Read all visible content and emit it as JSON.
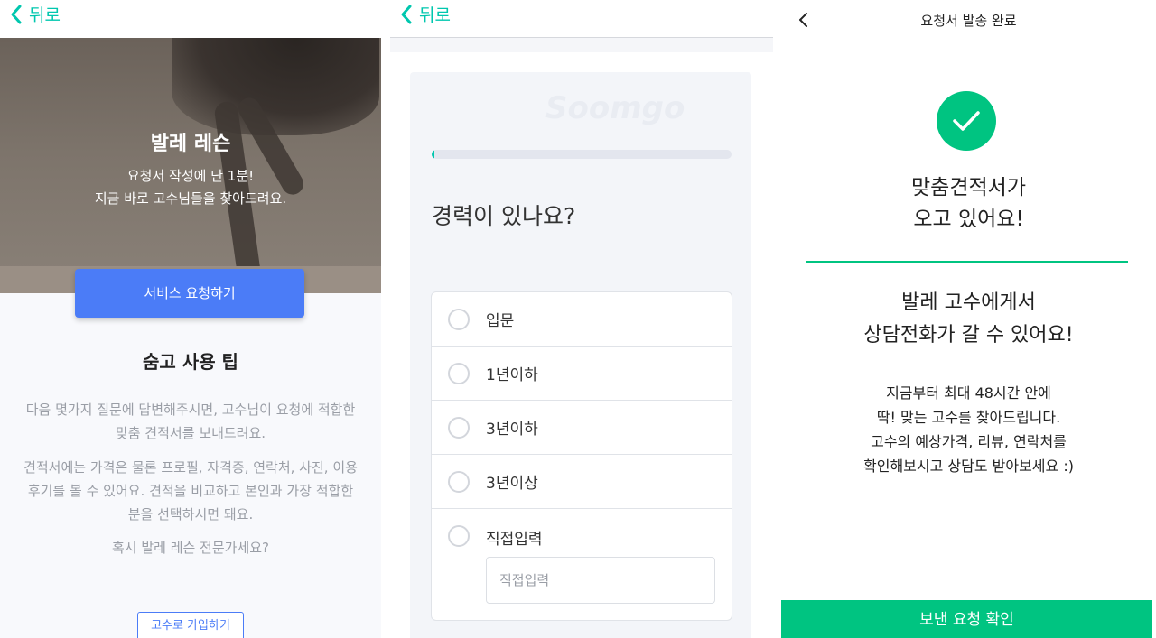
{
  "panel1": {
    "back_label": "뒤로",
    "hero_title": "발레 레슨",
    "hero_sub_line1": "요청서 작성에 단 1분!",
    "hero_sub_line2": "지금 바로 고수님들을 찾아드려요.",
    "request_button": "서비스 요청하기",
    "tips_title": "숨고 사용 팁",
    "tip1_line1": "다음 몇가지 질문에 답변해주시면, 고수님이 요청에 적합한",
    "tip1_line2": "맞춤 견적서를 보내드려요.",
    "tip2_line1": "견적서에는 가격은 물론 프로필, 자격증, 연락처, 사진, 이용",
    "tip2_line2": "후기를 볼 수 있어요. 견적을 비교하고 본인과 가장 적합한",
    "tip2_line3": "분을 선택하시면 돼요.",
    "tip3": "혹시 발레 레슨 전문가세요?",
    "pro_signup_button": "고수로 가입하기"
  },
  "panel2": {
    "back_label": "뒤로",
    "watermark": "Soomgo",
    "progress_percent": 1,
    "question": "경력이 있나요?",
    "options": [
      {
        "label": "입문"
      },
      {
        "label": "1년이하"
      },
      {
        "label": "3년이하"
      },
      {
        "label": "3년이상"
      },
      {
        "label": "직접입력"
      }
    ],
    "direct_input_placeholder": "직접입력"
  },
  "panel3": {
    "header_title": "요청서 발송 완료",
    "success_line1": "맞춤견적서가",
    "success_line2": "오고 있어요!",
    "call_line1": "발레 고수에게서",
    "call_line2": "상담전화가 갈 수 있어요!",
    "info_line1": "지금부터 최대 48시간 안에",
    "info_line2": "딱! 맞는 고수를 찾아드립니다.",
    "info_line3": "고수의 예상가격, 리뷰, 연락처를",
    "info_line4": "확인해보시고 상담도 받아보세요 :)",
    "confirm_button": "보낸 요청 확인"
  },
  "colors": {
    "accent_teal": "#00c7ae",
    "accent_green": "#00c481",
    "primary_blue": "#4b7cf7"
  },
  "icons": {
    "back": "chevron-left-icon",
    "success": "check-icon",
    "radio": "radio-unchecked-icon"
  }
}
